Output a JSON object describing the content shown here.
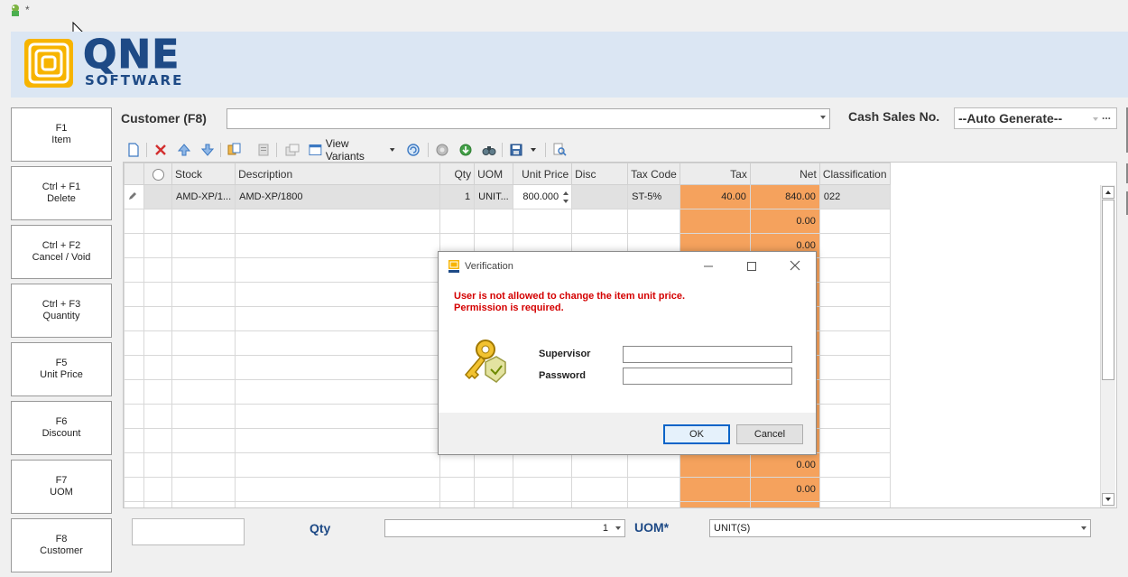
{
  "titlebar": {
    "modified_marker": "*"
  },
  "logo": {
    "word": "QNE",
    "sub": "SOFTWARE"
  },
  "function_keys": [
    {
      "key": "F1",
      "label": "Item"
    },
    {
      "key": "Ctrl + F1",
      "label": "Delete"
    },
    {
      "key": "Ctrl + F2",
      "label": "Cancel / Void"
    },
    {
      "key": "Ctrl + F3",
      "label": "Quantity"
    },
    {
      "key": "F5",
      "label": "Unit Price"
    },
    {
      "key": "F6",
      "label": "Discount"
    },
    {
      "key": "F7",
      "label": "UOM"
    },
    {
      "key": "F8",
      "label": "Customer"
    }
  ],
  "header": {
    "customer_label": "Customer (F8)",
    "customer_value": "",
    "cash_sales_label": "Cash Sales No.",
    "cash_sales_value": "--Auto Generate--",
    "ellipsis": "..."
  },
  "toolbar": {
    "view_variants_label": "View Variants"
  },
  "grid": {
    "columns": {
      "stock": "Stock",
      "description": "Description",
      "qty": "Qty",
      "uom": "UOM",
      "unit_price": "Unit Price",
      "disc": "Disc",
      "tax_code": "Tax Code",
      "tax": "Tax",
      "net": "Net",
      "classification": "Classification"
    },
    "rows": [
      {
        "stock": "AMD-XP/1...",
        "description": "AMD-XP/1800",
        "qty": "1",
        "uom": "UNIT...",
        "unit_price": "800.000",
        "disc": "",
        "tax_code": "ST-5%",
        "tax": "40.00",
        "net": "840.00",
        "classification": "022"
      },
      {
        "stock": "",
        "description": "",
        "qty": "",
        "uom": "",
        "unit_price": "",
        "disc": "",
        "tax_code": "",
        "tax": "",
        "net": "0.00",
        "classification": ""
      },
      {
        "stock": "",
        "description": "",
        "qty": "",
        "uom": "",
        "unit_price": "",
        "disc": "",
        "tax_code": "",
        "tax": "",
        "net": "0.00",
        "classification": ""
      },
      {
        "stock": "",
        "description": "",
        "qty": "",
        "uom": "",
        "unit_price": "",
        "disc": "",
        "tax_code": "",
        "tax": "",
        "net": "",
        "classification": ""
      },
      {
        "stock": "",
        "description": "",
        "qty": "",
        "uom": "",
        "unit_price": "",
        "disc": "",
        "tax_code": "",
        "tax": "",
        "net": "",
        "classification": ""
      },
      {
        "stock": "",
        "description": "",
        "qty": "",
        "uom": "",
        "unit_price": "",
        "disc": "",
        "tax_code": "",
        "tax": "",
        "net": "",
        "classification": ""
      },
      {
        "stock": "",
        "description": "",
        "qty": "",
        "uom": "",
        "unit_price": "",
        "disc": "",
        "tax_code": "",
        "tax": "",
        "net": "",
        "classification": ""
      },
      {
        "stock": "",
        "description": "",
        "qty": "",
        "uom": "",
        "unit_price": "",
        "disc": "",
        "tax_code": "",
        "tax": "",
        "net": "",
        "classification": ""
      },
      {
        "stock": "",
        "description": "",
        "qty": "",
        "uom": "",
        "unit_price": "",
        "disc": "",
        "tax_code": "",
        "tax": "",
        "net": "",
        "classification": ""
      },
      {
        "stock": "",
        "description": "",
        "qty": "",
        "uom": "",
        "unit_price": "",
        "disc": "",
        "tax_code": "",
        "tax": "",
        "net": "",
        "classification": ""
      },
      {
        "stock": "",
        "description": "",
        "qty": "",
        "uom": "",
        "unit_price": "",
        "disc": "",
        "tax_code": "",
        "tax": "",
        "net": "",
        "classification": ""
      },
      {
        "stock": "",
        "description": "",
        "qty": "",
        "uom": "",
        "unit_price": "",
        "disc": "",
        "tax_code": "",
        "tax": "",
        "net": "0.00",
        "classification": ""
      },
      {
        "stock": "",
        "description": "",
        "qty": "",
        "uom": "",
        "unit_price": "",
        "disc": "",
        "tax_code": "",
        "tax": "",
        "net": "0.00",
        "classification": ""
      },
      {
        "stock": "",
        "description": "",
        "qty": "",
        "uom": "",
        "unit_price": "",
        "disc": "",
        "tax_code": "",
        "tax": "",
        "net": "",
        "classification": ""
      }
    ]
  },
  "bottom": {
    "qty_label": "Qty",
    "qty_value": "1",
    "uom_label": "UOM*",
    "uom_value": "UNIT(S)"
  },
  "dialog": {
    "title": "Verification",
    "message_line1": "User is not allowed to change the item unit price.",
    "message_line2": "Permission is required.",
    "supervisor_label": "Supervisor",
    "password_label": "Password",
    "supervisor_value": "",
    "password_value": "",
    "ok_label": "OK",
    "cancel_label": "Cancel"
  },
  "colors": {
    "banner": "#dbe6f3",
    "brand": "#1e4a86",
    "tax_net_cell": "#f5a25d",
    "error_text": "#d40000"
  }
}
